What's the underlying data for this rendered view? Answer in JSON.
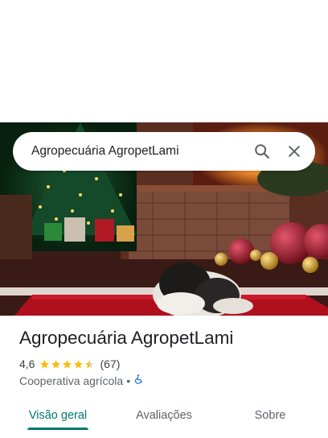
{
  "search": {
    "query": "Agropecuária AgropetLami",
    "search_icon": "search-icon",
    "close_icon": "close-icon"
  },
  "place": {
    "name": "Agropecuária AgropetLami",
    "rating": "4,6",
    "rating_value": 4.6,
    "review_count": "(67)",
    "category": "Cooperativa agrícola",
    "separator": "•",
    "accessibility_icon": "wheelchair-icon"
  },
  "tabs": [
    {
      "label": "Visão geral",
      "active": true
    },
    {
      "label": "Avaliações",
      "active": false
    },
    {
      "label": "Sobre",
      "active": false
    }
  ],
  "colors": {
    "accent": "#00796b",
    "star": "#fbbc04",
    "accessibility": "#1a73e8"
  }
}
